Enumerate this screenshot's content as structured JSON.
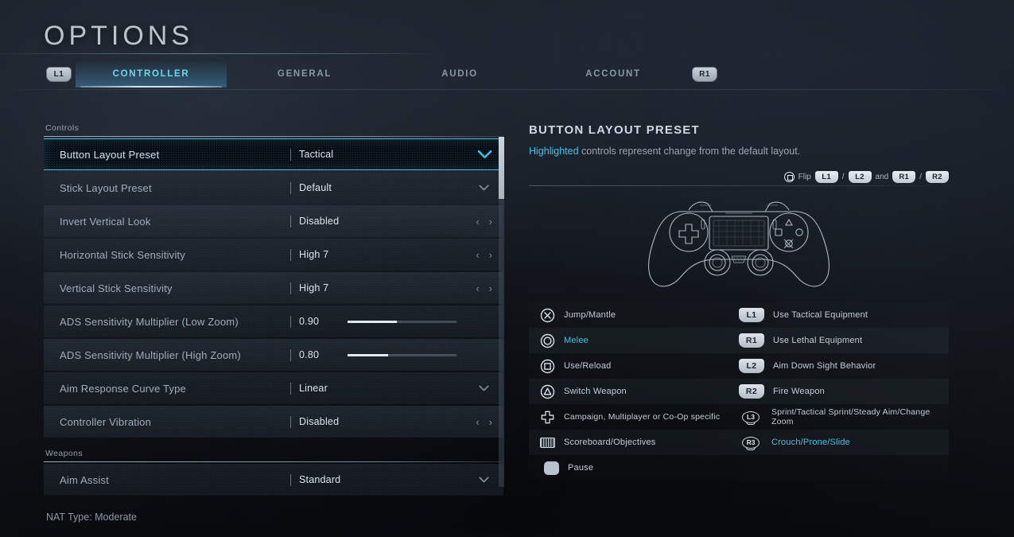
{
  "header": {
    "title": "OPTIONS",
    "tabs": [
      {
        "label": "CONTROLLER",
        "active": true
      },
      {
        "label": "GENERAL",
        "active": false
      },
      {
        "label": "AUDIO",
        "active": false
      },
      {
        "label": "ACCOUNT",
        "active": false
      }
    ],
    "left_bumper": "L1",
    "right_bumper": "R1"
  },
  "settings": {
    "sections": [
      {
        "label": "Controls",
        "rows": [
          {
            "label": "Button Layout Preset",
            "value": "Tactical",
            "control": "dropdown",
            "selected": true
          },
          {
            "label": "Stick Layout Preset",
            "value": "Default",
            "control": "dropdown",
            "selected": false
          },
          {
            "label": "Invert Vertical Look",
            "value": "Disabled",
            "control": "arrows",
            "selected": false
          },
          {
            "label": "Horizontal Stick Sensitivity",
            "value": "High 7",
            "control": "arrows",
            "selected": false
          },
          {
            "label": "Vertical Stick Sensitivity",
            "value": "High 7",
            "control": "arrows",
            "selected": false
          },
          {
            "label": "ADS Sensitivity Multiplier (Low Zoom)",
            "value": "0.90",
            "control": "slider",
            "fill_percent": 45,
            "selected": false
          },
          {
            "label": "ADS Sensitivity Multiplier (High Zoom)",
            "value": "0.80",
            "control": "slider",
            "fill_percent": 37,
            "selected": false
          },
          {
            "label": "Aim Response Curve Type",
            "value": "Linear",
            "control": "dropdown",
            "selected": false
          },
          {
            "label": "Controller Vibration",
            "value": "Disabled",
            "control": "arrows",
            "selected": false
          }
        ]
      },
      {
        "label": "Weapons",
        "rows": [
          {
            "label": "Aim Assist",
            "value": "Standard",
            "control": "dropdown",
            "selected": false
          }
        ]
      }
    ],
    "arrow_left": "‹",
    "arrow_right": "›"
  },
  "detail": {
    "title": "BUTTON LAYOUT PRESET",
    "desc_highlight": "Highlighted",
    "desc_rest": " controls represent change from the default layout.",
    "flip_hint": {
      "icon": "square-button-icon",
      "label": "Flip",
      "keys": [
        "L1",
        "L2",
        "R1",
        "R2"
      ],
      "separator": "/",
      "conjunction": "and"
    },
    "controller_image": "dualshock-controller-diagram",
    "bindings": [
      {
        "left_icon": "ps-cross-icon",
        "left_text": "Jump/Mantle",
        "left_highlight": false,
        "right_icon": "L1",
        "right_icon_type": "key",
        "right_text": "Use Tactical Equipment",
        "right_highlight": false
      },
      {
        "left_icon": "ps-circle-icon",
        "left_text": "Melee",
        "left_highlight": true,
        "right_icon": "R1",
        "right_icon_type": "key",
        "right_text": "Use Lethal Equipment",
        "right_highlight": false
      },
      {
        "left_icon": "ps-square-icon",
        "left_text": "Use/Reload",
        "left_highlight": false,
        "right_icon": "L2",
        "right_icon_type": "key",
        "right_text": "Aim Down Sight Behavior",
        "right_highlight": false
      },
      {
        "left_icon": "ps-triangle-icon",
        "left_text": "Switch Weapon",
        "left_highlight": false,
        "right_icon": "R2",
        "right_icon_type": "key",
        "right_text": "Fire Weapon",
        "right_highlight": false
      },
      {
        "left_icon": "dpad-icon",
        "left_text": "Campaign, Multiplayer or Co-Op specific",
        "left_highlight": false,
        "right_icon": "L3",
        "right_icon_type": "stick",
        "right_text": "Sprint/Tactical Sprint/Steady Aim/Change Zoom",
        "right_highlight": false
      },
      {
        "left_icon": "touchpad-icon",
        "left_text": "Scoreboard/Objectives",
        "left_highlight": false,
        "right_icon": "R3",
        "right_icon_type": "stick",
        "right_text": "Crouch/Prone/Slide",
        "right_highlight": true
      },
      {
        "left_icon": "options-button-icon",
        "left_text": "Pause",
        "left_highlight": false,
        "right_icon": "",
        "right_icon_type": "none",
        "right_text": "",
        "right_highlight": false
      }
    ]
  },
  "footer": {
    "nat_type": "NAT Type: Moderate"
  },
  "colors": {
    "accent": "#3fc4e8",
    "selected_border": "#58b8d8",
    "key_light": "#dde4ea"
  }
}
